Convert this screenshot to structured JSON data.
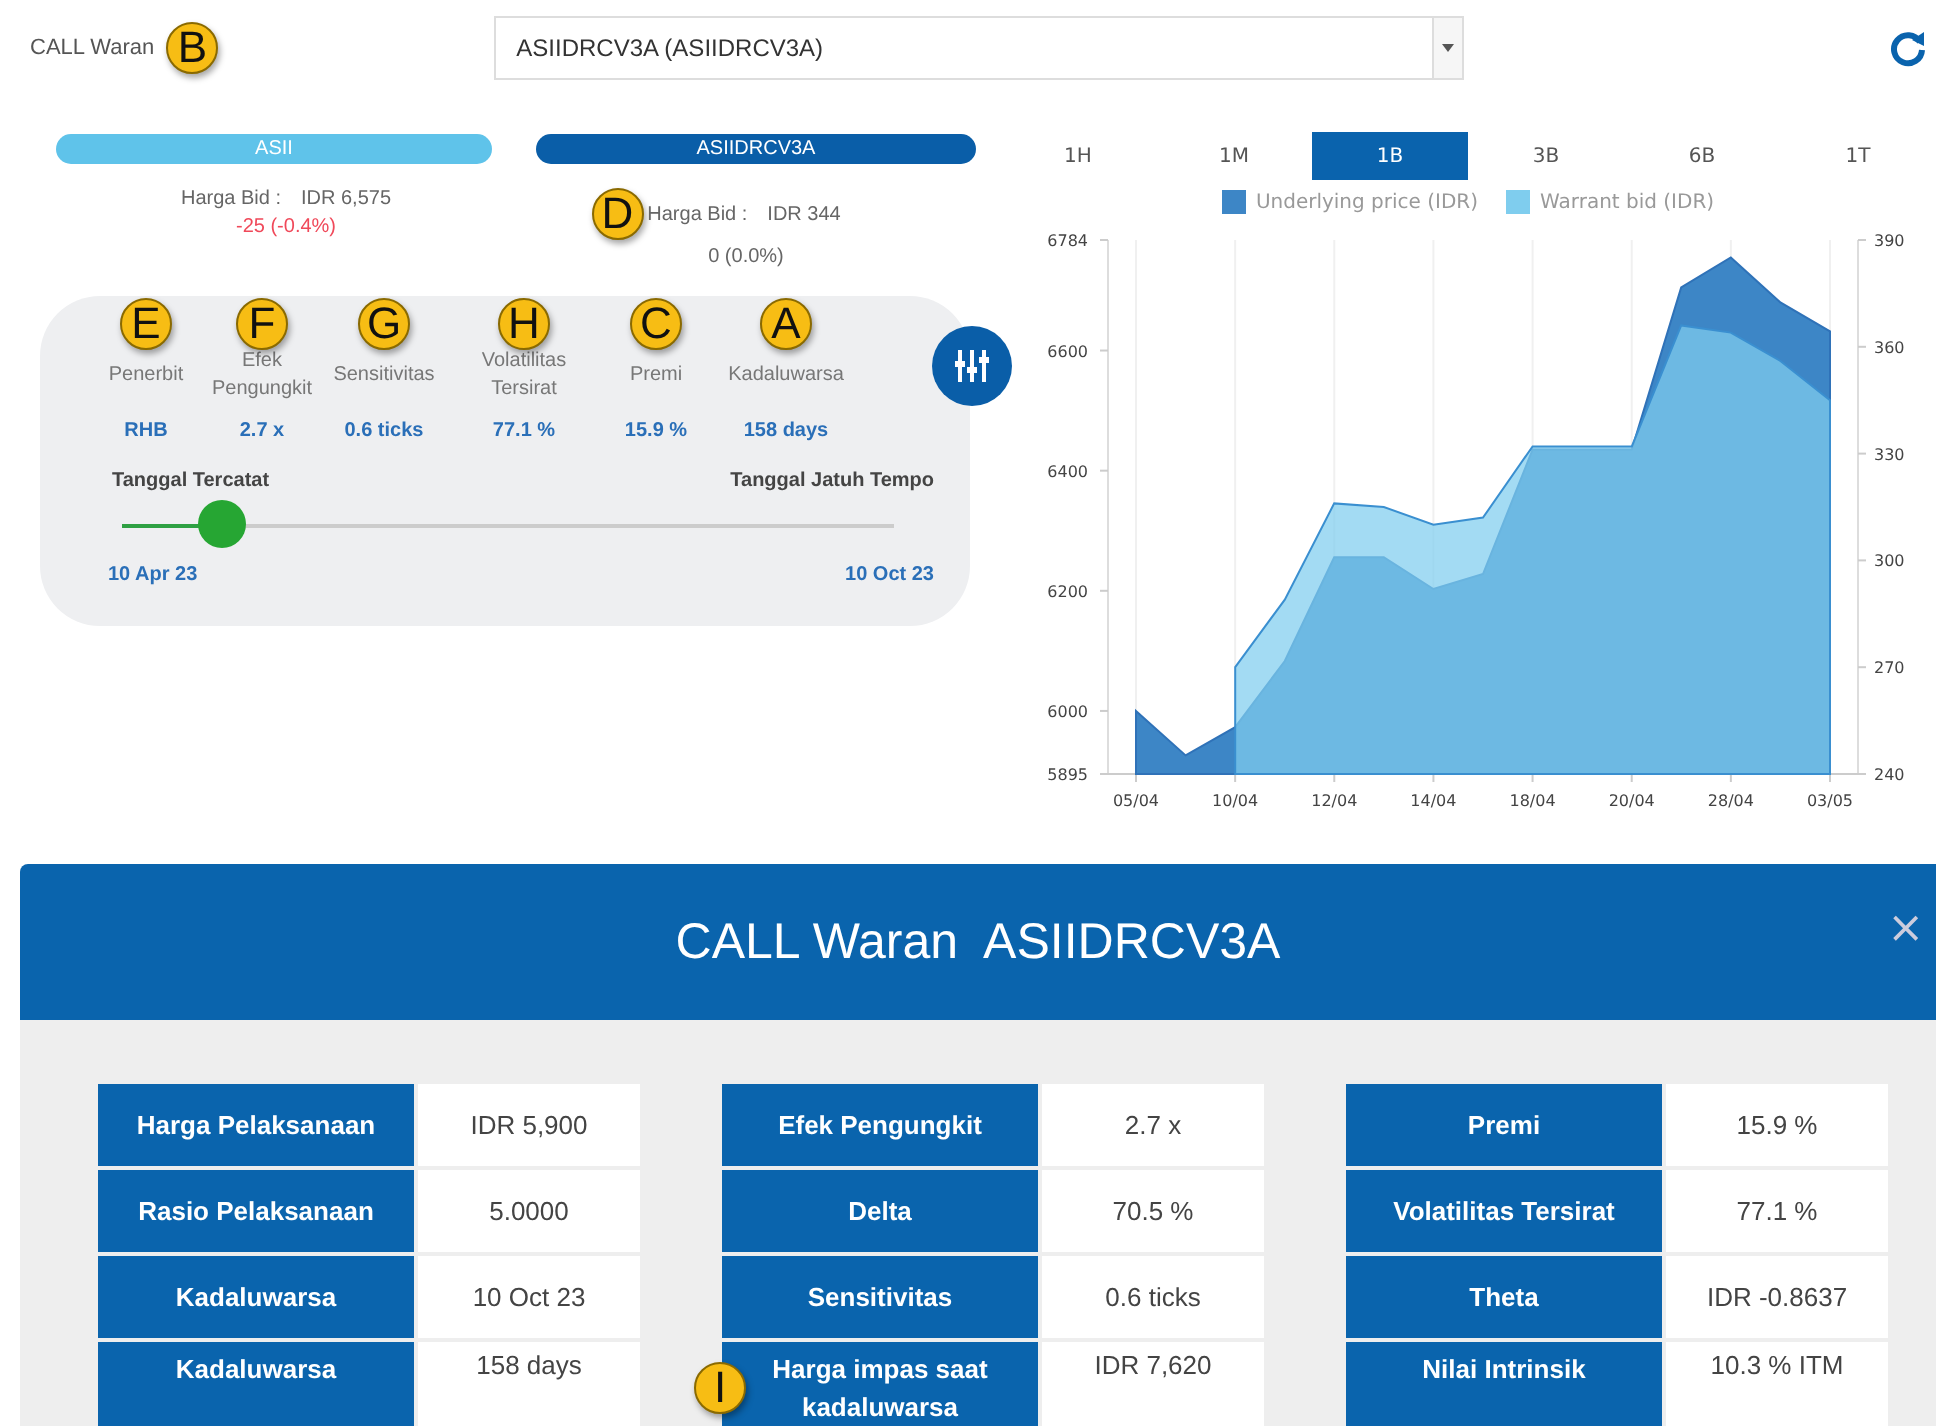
{
  "header": {
    "title": "CALL Waran",
    "title_callout": "B",
    "selected_warrant": "ASIIDRCV3A (ASIIDRCV3A)"
  },
  "instruments": [
    {
      "name": "ASII",
      "kind": "underlying",
      "bid_label": "Harga Bid :",
      "bid": "IDR 6,575",
      "change": "-25 (-0.4%)",
      "color": "#f0495a"
    },
    {
      "name": "ASIIDRCV3A",
      "kind": "warrant",
      "bid_label": "Harga Bid :",
      "bid": "IDR 344",
      "change": "0 (0.0%)",
      "color": "#666666",
      "callout": "D"
    }
  ],
  "metrics": [
    {
      "label": "Penerbit",
      "value": "RHB",
      "callout": "E"
    },
    {
      "label": "Efek Pengungkit",
      "value": "2.7 x",
      "callout": "F"
    },
    {
      "label": "Sensitivitas",
      "value": "0.6 ticks",
      "callout": "G"
    },
    {
      "label": "Volatilitas Tersirat",
      "value": "77.1 %",
      "callout": "H"
    },
    {
      "label": "Premi",
      "value": "15.9 %",
      "callout": "C"
    },
    {
      "label": "Kadaluwarsa",
      "value": "158 days",
      "callout": "A"
    }
  ],
  "timeline": {
    "start_label": "Tanggal Tercatat",
    "end_label": "Tanggal Jatuh Tempo",
    "level": 0.13,
    "start_date": "10 Apr 23",
    "end_date": "10 Oct 23"
  },
  "periods": [
    {
      "label": "1H",
      "selected": false
    },
    {
      "label": "1M",
      "selected": false
    },
    {
      "label": "1B",
      "selected": true
    },
    {
      "label": "3B",
      "selected": false
    },
    {
      "label": "6B",
      "selected": false
    },
    {
      "label": "1T",
      "selected": false
    }
  ],
  "chart_data": {
    "type": "area",
    "grid": true,
    "categories": [
      "05/04",
      null,
      "10/04",
      null,
      "12/04",
      null,
      "14/04",
      null,
      "18/04",
      null,
      "20/04",
      null,
      "28/04",
      null,
      "03/05"
    ],
    "ylim": [
      5895,
      6784
    ],
    "yticks": [
      5895,
      6000,
      6200,
      6400,
      6600,
      6784
    ],
    "y2lim": [
      240,
      390
    ],
    "y2ticks": [
      240,
      270,
      300,
      330,
      360,
      390
    ],
    "series": [
      {
        "name": "Underlying price (IDR)",
        "color": "#3d86c6",
        "values": [
          6000,
          5926,
          5973,
          6083,
          6256,
          6256,
          6203,
          6228,
          6435,
          6435,
          6435,
          6705,
          6755,
          6680,
          6632
        ]
      },
      {
        "name": "Warrant bid (IDR)",
        "color": "#7fcdee",
        "axis": "y2",
        "values": [
          null,
          null,
          270,
          289,
          316,
          315,
          310,
          312,
          332,
          332,
          332,
          366,
          364,
          356,
          345
        ]
      }
    ]
  },
  "detail": {
    "title": "CALL Waran  ASIIDRCV3A",
    "close": "×",
    "tables": [
      [
        {
          "label": "Harga Pelaksanaan",
          "value": "IDR 5,900"
        },
        {
          "label": "Rasio Pelaksanaan",
          "value": "5.0000"
        },
        {
          "label": "Kadaluwarsa",
          "value": "10 Oct 23"
        },
        {
          "label": "Kadaluwarsa",
          "value": "158 days"
        }
      ],
      [
        {
          "label": "Efek Pengungkit",
          "value": "2.7 x"
        },
        {
          "label": "Delta",
          "value": "70.5 %"
        },
        {
          "label": "Sensitivitas",
          "value": "0.6 ticks"
        },
        {
          "label": "Harga impas saat kadaluwarsa",
          "value": "IDR 7,620",
          "callout": "I"
        }
      ],
      [
        {
          "label": "Premi",
          "value": "15.9 %"
        },
        {
          "label": "Volatilitas Tersirat",
          "value": "77.1 %"
        },
        {
          "label": "Theta",
          "value": "IDR -0.8637"
        },
        {
          "label": "Nilai Intrinsik",
          "value": "10.3 % ITM"
        }
      ]
    ]
  }
}
